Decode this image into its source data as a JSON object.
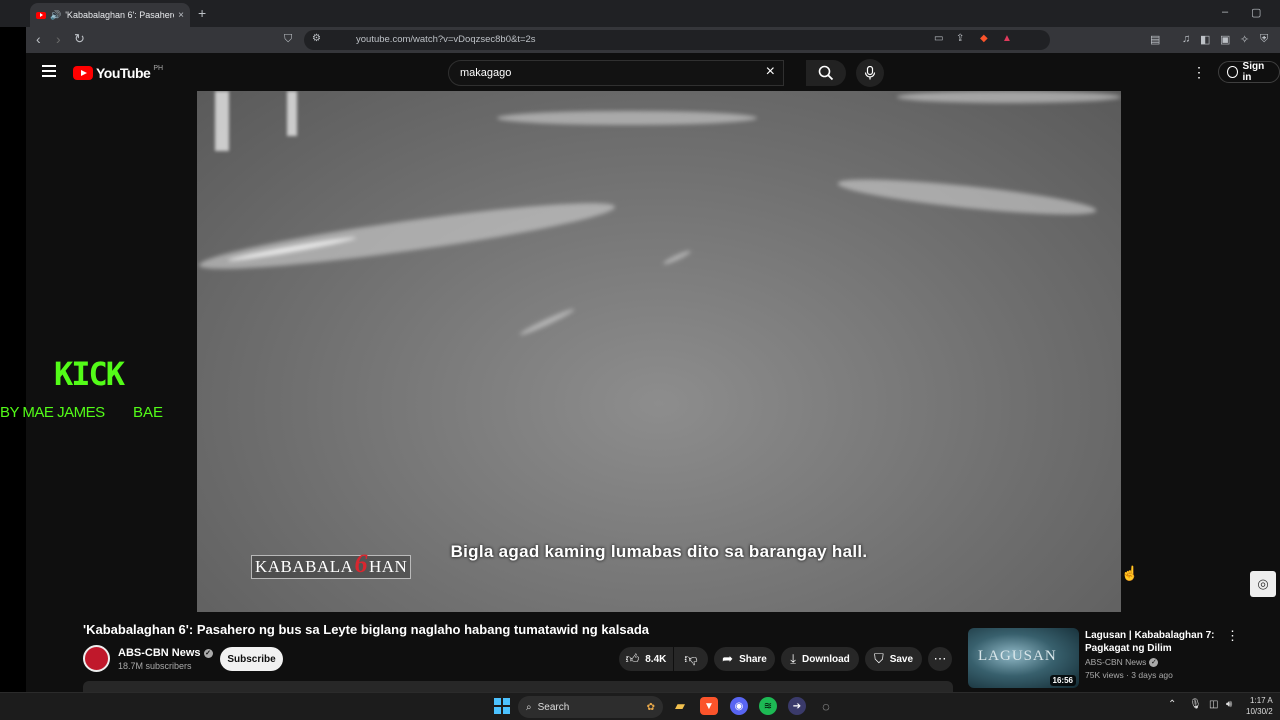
{
  "browser": {
    "tab_title": "'Kababalaghan 6': Pasahero ng",
    "url": "youtube.com/watch?v=vDoqzsec8b0&t=2s",
    "new_tab": "+",
    "close_tab": "×",
    "minimize": "–",
    "maximize": "▢"
  },
  "youtube": {
    "logo_text": "YouTube",
    "region": "PH",
    "search_query": "makagago",
    "sign_in": "Sign in"
  },
  "overlay": {
    "kick": "KICK",
    "by_line": "BY MAE JAMES",
    "bae": "BAE"
  },
  "video": {
    "subtitle": "Bigla agad kaming lumabas dito sa barangay hall.",
    "show_logo_left": "KABABALA",
    "show_logo_six": "6",
    "show_logo_right": "HAN"
  },
  "details": {
    "title": "'Kababalaghan 6': Pasahero ng bus sa Leyte biglang naglaho habang tumatawid ng kalsada",
    "channel": "ABS-CBN News",
    "subscribers": "18.7M subscribers",
    "subscribe": "Subscribe",
    "likes": "8.4K",
    "share": "Share",
    "download": "Download",
    "save": "Save"
  },
  "recommended": {
    "thumb_text": "LAGUSAN",
    "duration": "16:56",
    "title": "Lagusan | Kababalaghan 7: Pagkagat ng Dilim",
    "channel": "ABS-CBN News",
    "meta": "75K views · 3 days ago"
  },
  "taskbar": {
    "search": "Search",
    "time": "1:17 A",
    "date": "10/30/2"
  },
  "colors": {
    "yt_red": "#ff0000",
    "kick_green": "#53fc18",
    "start_blue": "#4cc2ff"
  }
}
